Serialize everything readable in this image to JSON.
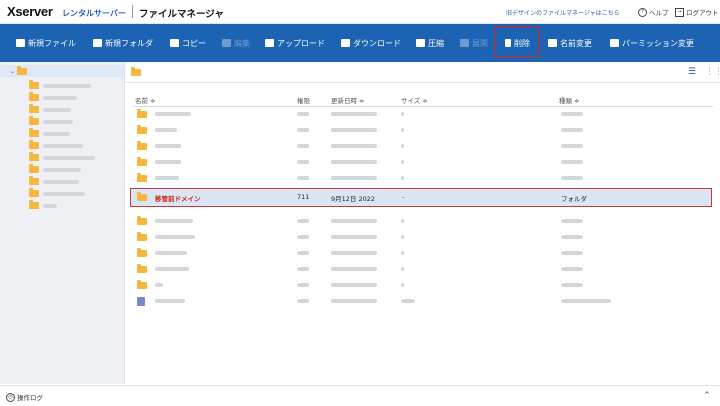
{
  "header": {
    "brand": "Xserver",
    "brand_sub": "レンタルサーバー",
    "app_title": "ファイルマネージャ",
    "old_design_link": "旧デザインのファイルマネージャはこちら",
    "help_label": "ヘルプ",
    "logout_label": "ログアウト"
  },
  "toolbar": {
    "items": [
      {
        "label": "新規ファイル",
        "icon": "new-file-icon",
        "enabled": true
      },
      {
        "label": "新規フォルダ",
        "icon": "new-folder-icon",
        "enabled": true
      },
      {
        "label": "コピー",
        "icon": "copy-icon",
        "enabled": true
      },
      {
        "label": "編集",
        "icon": "edit-icon",
        "enabled": false
      },
      {
        "label": "アップロード",
        "icon": "upload-icon",
        "enabled": true
      },
      {
        "label": "ダウンロード",
        "icon": "download-icon",
        "enabled": true
      },
      {
        "label": "圧縮",
        "icon": "compress-icon",
        "enabled": true
      },
      {
        "label": "展開",
        "icon": "extract-icon",
        "enabled": false
      },
      {
        "label": "削除",
        "icon": "trash-icon",
        "enabled": true,
        "highlighted": true
      },
      {
        "label": "名前変更",
        "icon": "rename-icon",
        "enabled": true
      },
      {
        "label": "パーミッション変更",
        "icon": "permission-icon",
        "enabled": true
      }
    ]
  },
  "table": {
    "columns": [
      "名前 ≑",
      "権限",
      "更新日時 ≑",
      "サイズ ≑",
      "種類 ≑"
    ],
    "selected_row": {
      "name": "移管前ドメイン",
      "permission": "711",
      "modified": "9月12日 2022",
      "size": "-",
      "type": "フォルダ"
    }
  },
  "footer": {
    "log_label": "操作ログ",
    "caret": "^"
  },
  "colors": {
    "toolbar_bg": "#1c63b3",
    "highlight_border": "#e0251d",
    "folder": "#f4b73f",
    "selected_row_bg": "#dbe6f4"
  }
}
